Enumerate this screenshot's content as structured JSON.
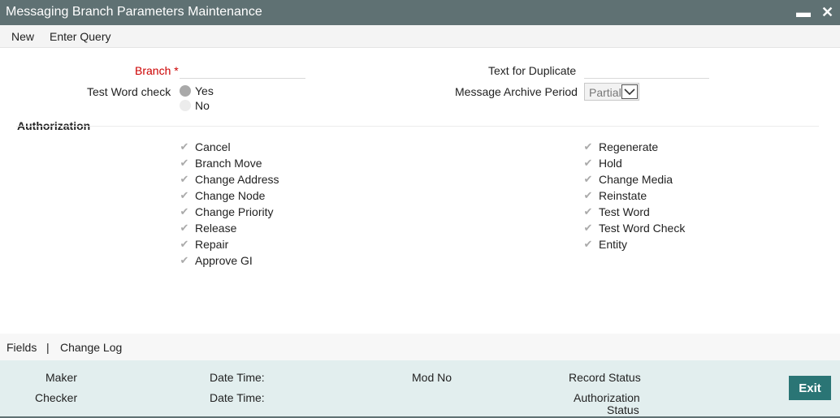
{
  "window": {
    "title": "Messaging Branch Parameters Maintenance",
    "minimize": "▬",
    "close": "✕"
  },
  "menu": {
    "new": "New",
    "enter_query": "Enter Query"
  },
  "form": {
    "branch_label": "Branch",
    "branch_required": "*",
    "test_word_check_label": "Test Word check",
    "radio_yes": "Yes",
    "radio_no": "No",
    "text_for_duplicate_label": "Text for Duplicate",
    "message_archive_period_label": "Message Archive Period",
    "message_archive_period_value": "Partial"
  },
  "authorization": {
    "heading": "Authorization",
    "left": [
      "Cancel",
      "Branch Move",
      "Change Address",
      "Change Node",
      "Change Priority",
      "Release",
      "Repair",
      "Approve GI"
    ],
    "right": [
      "Regenerate",
      "Hold",
      "Change Media",
      "Reinstate",
      "Test Word",
      "Test Word Check",
      "Entity"
    ]
  },
  "footer": {
    "fields": "Fields",
    "separator": "|",
    "change_log": "Change Log"
  },
  "status": {
    "maker": "Maker",
    "checker": "Checker",
    "date_time_1": "Date Time:",
    "date_time_2": "Date Time:",
    "mod_no": "Mod No",
    "record_status": "Record Status",
    "authorization_status_1": "Authorization",
    "authorization_status_2": "Status",
    "exit": "Exit"
  }
}
